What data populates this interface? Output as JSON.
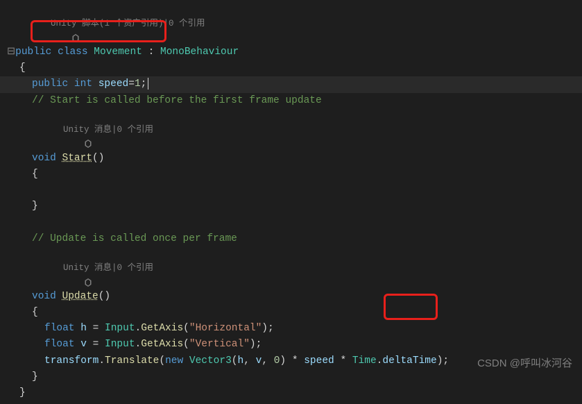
{
  "codelens": {
    "scriptHeader": "Unity 脚本(1 个资产引用)|0 个引用",
    "startHeader": "Unity 消息|0 个引用",
    "updateHeader": "Unity 消息|0 个引用"
  },
  "code": {
    "classDecl": {
      "public": "public",
      "class": "class",
      "name": "Movement",
      "colon": ":",
      "base": "MonoBehaviour"
    },
    "field": {
      "public": "public",
      "type": "int",
      "name": "speed",
      "eq": "=",
      "value": "1",
      "semi": ";"
    },
    "commentStart": "// Start is called before the first frame update",
    "startMethod": {
      "void": "void",
      "name": "Start",
      "parens": "()"
    },
    "commentUpdate": "// Update is called once per frame",
    "updateMethod": {
      "void": "void",
      "name": "Update",
      "parens": "()"
    },
    "line_h": {
      "float": "float",
      "var": "h",
      "eq": "=",
      "Input": "Input",
      "GetAxis": "GetAxis",
      "arg": "\"Horizontal\"",
      "semi": ";"
    },
    "line_v": {
      "float": "float",
      "var": "v",
      "eq": "=",
      "Input": "Input",
      "GetAxis": "GetAxis",
      "arg": "\"Vertical\"",
      "semi": ";"
    },
    "line_transform": {
      "transform": "transform",
      "Translate": "Translate",
      "new": "new",
      "Vector3": "Vector3",
      "h": "h",
      "v": "v",
      "zero": "0",
      "speed": "speed",
      "Time": "Time",
      "deltaTime": "deltaTime",
      "semi": ";"
    }
  },
  "braces": {
    "open": "{",
    "close": "}"
  },
  "watermark": "CSDN @呼叫冰河谷"
}
